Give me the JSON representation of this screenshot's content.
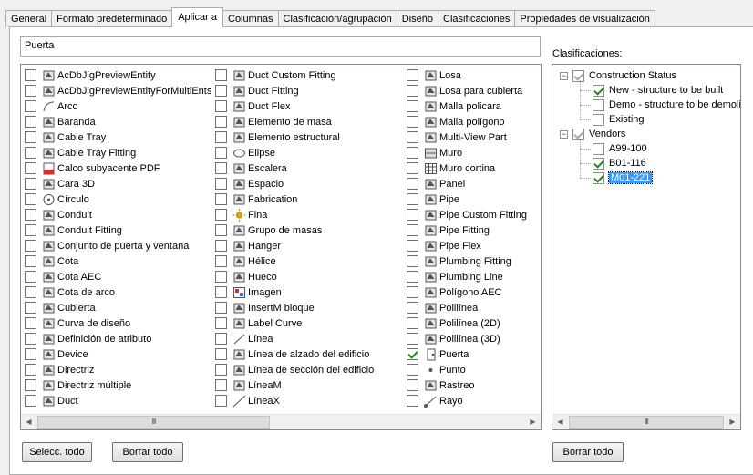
{
  "tabs": [
    {
      "label": "General",
      "active": false
    },
    {
      "label": "Formato predeterminado",
      "active": false
    },
    {
      "label": "Aplicar a",
      "active": true
    },
    {
      "label": "Columnas",
      "active": false
    },
    {
      "label": "Clasificación/agrupación",
      "active": false
    },
    {
      "label": "Diseño",
      "active": false
    },
    {
      "label": "Clasificaciones",
      "active": false
    },
    {
      "label": "Propiedades de visualización",
      "active": false
    }
  ],
  "filter": {
    "value": "Puerta"
  },
  "columns": [
    [
      {
        "label": "AcDbJigPreviewEntity",
        "icon": "preview-entity-icon",
        "checked": false
      },
      {
        "label": "AcDbJigPreviewEntityForMultiEnts",
        "icon": "preview-entity-multi-icon",
        "checked": false
      },
      {
        "label": "Arco",
        "icon": "arc-icon",
        "checked": false
      },
      {
        "label": "Baranda",
        "icon": "railing-icon",
        "checked": false
      },
      {
        "label": "Cable Tray",
        "icon": "cable-tray-icon",
        "checked": false
      },
      {
        "label": "Cable Tray Fitting",
        "icon": "cable-tray-fitting-icon",
        "checked": false
      },
      {
        "label": "Calco subyacente PDF",
        "icon": "pdf-underlay-icon",
        "checked": false
      },
      {
        "label": "Cara 3D",
        "icon": "face-3d-icon",
        "checked": false
      },
      {
        "label": "Círculo",
        "icon": "circle-icon",
        "checked": false
      },
      {
        "label": "Conduit",
        "icon": "conduit-icon",
        "checked": false
      },
      {
        "label": "Conduit Fitting",
        "icon": "conduit-fitting-icon",
        "checked": false
      },
      {
        "label": "Conjunto de puerta y ventana",
        "icon": "door-window-assembly-icon",
        "checked": false
      },
      {
        "label": "Cota",
        "icon": "dimension-icon",
        "checked": false
      },
      {
        "label": "Cota AEC",
        "icon": "aec-dimension-icon",
        "checked": false
      },
      {
        "label": "Cota de arco",
        "icon": "arc-dimension-icon",
        "checked": false
      },
      {
        "label": "Cubierta",
        "icon": "roof-icon",
        "checked": false
      },
      {
        "label": "Curva de diseño",
        "icon": "layout-curve-icon",
        "checked": false
      },
      {
        "label": "Definición de atributo",
        "icon": "attribute-definition-icon",
        "checked": false
      },
      {
        "label": "Device",
        "icon": "device-icon",
        "checked": false
      },
      {
        "label": "Directriz",
        "icon": "leader-icon",
        "checked": false
      },
      {
        "label": "Directriz múltiple",
        "icon": "multileader-icon",
        "checked": false
      },
      {
        "label": "Duct",
        "icon": "duct-icon",
        "checked": false
      }
    ],
    [
      {
        "label": "Duct Custom Fitting",
        "icon": "duct-custom-fitting-icon",
        "checked": false
      },
      {
        "label": "Duct Fitting",
        "icon": "duct-fitting-icon",
        "checked": false
      },
      {
        "label": "Duct Flex",
        "icon": "duct-flex-icon",
        "checked": false
      },
      {
        "label": "Elemento de masa",
        "icon": "mass-element-icon",
        "checked": false
      },
      {
        "label": "Elemento estructural",
        "icon": "structural-member-icon",
        "checked": false
      },
      {
        "label": "Elipse",
        "icon": "ellipse-icon",
        "checked": false
      },
      {
        "label": "Escalera",
        "icon": "stair-icon",
        "checked": false
      },
      {
        "label": "Espacio",
        "icon": "space-icon",
        "checked": false
      },
      {
        "label": "Fabrication",
        "icon": "fabrication-icon",
        "checked": false
      },
      {
        "label": "Fina",
        "icon": "sun-icon",
        "checked": false
      },
      {
        "label": "Grupo de masas",
        "icon": "mass-group-icon",
        "checked": false
      },
      {
        "label": "Hanger",
        "icon": "hanger-icon",
        "checked": false
      },
      {
        "label": "Hélice",
        "icon": "helix-icon",
        "checked": false
      },
      {
        "label": "Hueco",
        "icon": "opening-icon",
        "checked": false
      },
      {
        "label": "Imagen",
        "icon": "image-icon",
        "checked": false
      },
      {
        "label": "InsertM bloque",
        "icon": "minsert-block-icon",
        "checked": false
      },
      {
        "label": "Label Curve",
        "icon": "label-curve-icon",
        "checked": false
      },
      {
        "label": "Línea",
        "icon": "line-icon",
        "checked": false
      },
      {
        "label": "Línea de alzado del edificio",
        "icon": "elevation-line-icon",
        "checked": false
      },
      {
        "label": "Línea de sección del edificio",
        "icon": "section-line-icon",
        "checked": false
      },
      {
        "label": "LíneaM",
        "icon": "mline-icon",
        "checked": false
      },
      {
        "label": "LíneaX",
        "icon": "xline-icon",
        "checked": false
      }
    ],
    [
      {
        "label": "Losa",
        "icon": "slab-icon",
        "checked": false
      },
      {
        "label": "Losa para cubierta",
        "icon": "roof-slab-icon",
        "checked": false
      },
      {
        "label": "Malla policara",
        "icon": "polyface-mesh-icon",
        "checked": false
      },
      {
        "label": "Malla polígono",
        "icon": "polygon-mesh-icon",
        "checked": false
      },
      {
        "label": "Multi-View Part",
        "icon": "multi-view-part-icon",
        "checked": false
      },
      {
        "label": "Muro",
        "icon": "wall-icon",
        "checked": false
      },
      {
        "label": "Muro cortina",
        "icon": "curtain-wall-icon",
        "checked": false
      },
      {
        "label": "Panel",
        "icon": "panel-icon",
        "checked": false
      },
      {
        "label": "Pipe",
        "icon": "pipe-icon",
        "checked": false
      },
      {
        "label": "Pipe Custom Fitting",
        "icon": "pipe-custom-fitting-icon",
        "checked": false
      },
      {
        "label": "Pipe Fitting",
        "icon": "pipe-fitting-icon",
        "checked": false
      },
      {
        "label": "Pipe Flex",
        "icon": "pipe-flex-icon",
        "checked": false
      },
      {
        "label": "Plumbing Fitting",
        "icon": "plumbing-fitting-icon",
        "checked": false
      },
      {
        "label": "Plumbing Line",
        "icon": "plumbing-line-icon",
        "checked": false
      },
      {
        "label": "Polígono AEC",
        "icon": "aec-polygon-icon",
        "checked": false
      },
      {
        "label": "Polilínea",
        "icon": "polyline-icon",
        "checked": false
      },
      {
        "label": "Polilínea (2D)",
        "icon": "polyline-2d-icon",
        "checked": false
      },
      {
        "label": "Polilínea (3D)",
        "icon": "polyline-3d-icon",
        "checked": false
      },
      {
        "label": "Puerta",
        "icon": "door-icon",
        "checked": true
      },
      {
        "label": "Punto",
        "icon": "point-icon",
        "checked": false
      },
      {
        "label": "Rastreo",
        "icon": "trace-icon",
        "checked": false
      },
      {
        "label": "Rayo",
        "icon": "ray-icon",
        "checked": false
      }
    ]
  ],
  "scrollbar_thumb": "III",
  "buttons": {
    "select_all": "Selecc. todo",
    "clear_all": "Borrar todo",
    "tree_clear_all": "Borrar todo"
  },
  "classifications_label": "Clasificaciones:",
  "tree": [
    {
      "label": "Construction Status",
      "children": [
        {
          "label": "New - structure to be built",
          "checked": true
        },
        {
          "label": "Demo - structure to be demolis",
          "checked": false
        },
        {
          "label": "Existing",
          "checked": false
        }
      ]
    },
    {
      "label": "Vendors",
      "children": [
        {
          "label": "A99-100",
          "checked": false
        },
        {
          "label": "B01-116",
          "checked": true
        },
        {
          "label": "M01-221",
          "checked": true,
          "selected": true
        }
      ]
    }
  ],
  "colors": {
    "selection": "#3399ff",
    "check": "#1a8a1a",
    "icon": "#555555"
  }
}
